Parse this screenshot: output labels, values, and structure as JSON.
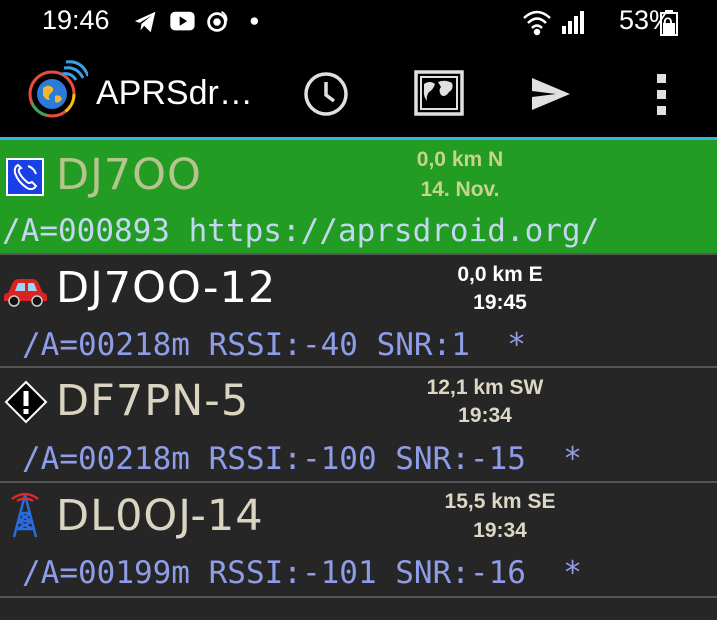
{
  "status_bar": {
    "time": "19:46",
    "battery_percent": "53%",
    "notification_icons": [
      "telegram-icon",
      "youtube-icon",
      "radio-wave-icon",
      "dot-icon"
    ],
    "system_icons": [
      "wifi-icon",
      "signal-icon",
      "battery-icon"
    ]
  },
  "action_bar": {
    "title": "APRSdr…",
    "icons": [
      "app-globe-icon",
      "clock-icon",
      "map-icon",
      "send-icon",
      "overflow-menu-icon"
    ]
  },
  "colors": {
    "highlight_row": "#239c23",
    "list_bg": "#262626",
    "comment": "#8f9de8",
    "accent": "#33b5e5"
  },
  "stations": [
    {
      "call": "DJ7OO",
      "distance": "0,0 km N",
      "time": "14. Nov.",
      "comment": "/A=000893 https://aprsdroid.org/",
      "symbol": "phone-icon",
      "call_color": "#b8c48e",
      "info_color": "#c7d48e",
      "comment_color": "#c2d8f0"
    },
    {
      "call": "DJ7OO-12",
      "distance": "0,0 km E",
      "time": "19:45",
      "comment": "/A=00218m RSSI:-40 SNR:1  *",
      "symbol": "car-icon",
      "call_color": "#ffffff",
      "info_color": "#ffffff",
      "comment_color": "#8f9de8"
    },
    {
      "call": "DF7PN-5",
      "distance": "12,1 km SW",
      "time": "19:34",
      "comment": "/A=00218m RSSI:-100 SNR:-15  *",
      "symbol": "diamond-info-icon",
      "call_color": "#d9d5c0",
      "info_color": "#ddd8c4",
      "comment_color": "#8f9de8"
    },
    {
      "call": "DL0OJ-14",
      "distance": "15,5 km SE",
      "time": "19:34",
      "comment": "/A=00199m RSSI:-101 SNR:-16  *",
      "symbol": "radio-tower-icon",
      "call_color": "#d9d5c0",
      "info_color": "#ddd8c4",
      "comment_color": "#8f9de8"
    }
  ]
}
